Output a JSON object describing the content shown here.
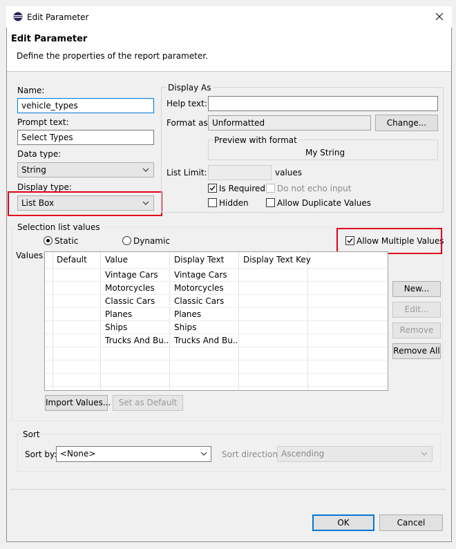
{
  "window": {
    "title": "Edit Parameter",
    "banner_title": "Edit Parameter",
    "banner_description": "Define the properties of the report parameter."
  },
  "left": {
    "name_label": "Name:",
    "name_value": "vehicle_types",
    "prompt_label": "Prompt text:",
    "prompt_value": "Select Types",
    "data_type_label": "Data type:",
    "data_type_value": "String",
    "display_type_label": "Display type:",
    "display_type_value": "List Box"
  },
  "display_as": {
    "group_label": "Display As",
    "help_text_label": "Help text:",
    "help_text_value": "",
    "format_as_label": "Format as:",
    "format_as_value": "Unformatted",
    "change_button": "Change...",
    "preview_label": "Preview with format",
    "preview_value": "My String",
    "list_limit_label": "List Limit:",
    "list_limit_value": "",
    "list_limit_suffix": "values",
    "is_required_label": "Is Required",
    "is_required_checked": true,
    "no_echo_label": "Do not echo input",
    "no_echo_checked": false,
    "hidden_label": "Hidden",
    "hidden_checked": false,
    "allow_duplicate_label": "Allow Duplicate Values",
    "allow_duplicate_checked": false
  },
  "selection": {
    "group_label": "Selection list values",
    "static_label": "Static",
    "static_selected": true,
    "dynamic_label": "Dynamic",
    "allow_multiple_label": "Allow Multiple Values",
    "allow_multiple_checked": true,
    "values_label": "Values:",
    "columns": [
      "Default",
      "Value",
      "Display Text",
      "Display Text Key"
    ],
    "rows": [
      {
        "default": "",
        "value": "Vintage Cars",
        "display": "Vintage Cars",
        "key": ""
      },
      {
        "default": "",
        "value": "Motorcycles",
        "display": "Motorcycles",
        "key": ""
      },
      {
        "default": "",
        "value": "Classic Cars",
        "display": "Classic Cars",
        "key": ""
      },
      {
        "default": "",
        "value": "Planes",
        "display": "Planes",
        "key": ""
      },
      {
        "default": "",
        "value": "Ships",
        "display": "Ships",
        "key": ""
      },
      {
        "default": "",
        "value": "Trucks And Bu...",
        "display": "Trucks And Bu...",
        "key": ""
      }
    ],
    "new_button": "New...",
    "edit_button": "Edit...",
    "remove_button": "Remove",
    "remove_all_button": "Remove All",
    "import_button": "Import Values...",
    "set_default_button": "Set as Default"
  },
  "sort": {
    "group_label": "Sort",
    "sort_by_label": "Sort by:",
    "sort_by_value": "<None>",
    "direction_label": "Sort direction:",
    "direction_value": "Ascending"
  },
  "footer": {
    "ok_button": "OK",
    "cancel_button": "Cancel"
  },
  "colors": {
    "highlight": "#e0001b",
    "default_button_border": "#0078d7"
  }
}
